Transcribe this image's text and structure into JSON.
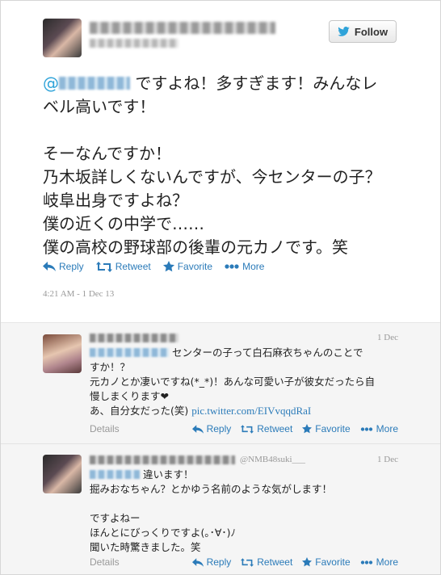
{
  "follow_label": "Follow",
  "main_tweet": {
    "mention_prefix": "@",
    "line1_after_mention": " ですよね！多すぎます！みんなレ",
    "line2": "ベル高いです！",
    "line3": "そーなんですか！",
    "line4": "乃木坂詳しくないんですが、今センターの子？",
    "line5": "岐阜出身ですよね？",
    "line6": "僕の近くの中学で……",
    "line7": "僕の高校の野球部の後輩の元カノです。笑",
    "timestamp": "4:21 AM - 1 Dec 13"
  },
  "actions": {
    "reply": "Reply",
    "retweet": "Retweet",
    "favorite": "Favorite",
    "more": "More"
  },
  "replies": [
    {
      "date": "1 Dec",
      "line1": "センターの子って白石麻衣ちゃんのことで",
      "line2": "すか！？",
      "line3": "元カノとか凄いですね(*_*)！あんな可愛い子が彼女だったら自",
      "line4": "慢しまくります",
      "heart": "❤",
      "line5": "あ、自分女だった(笑) ",
      "link": "pic.twitter.com/EIVvqqdRaI",
      "details": "Details"
    },
    {
      "handle": "@NMB48suki___",
      "date": "1 Dec",
      "line1": "違います！",
      "line2": "掘みおなちゃん？とかゆう名前のような気がします！",
      "line3": "ですよねー",
      "line4": "ほんとにびっくりですよ(｡･∀･)ﾉ",
      "line5": "聞いた時驚きました。笑",
      "details": "Details"
    }
  ]
}
